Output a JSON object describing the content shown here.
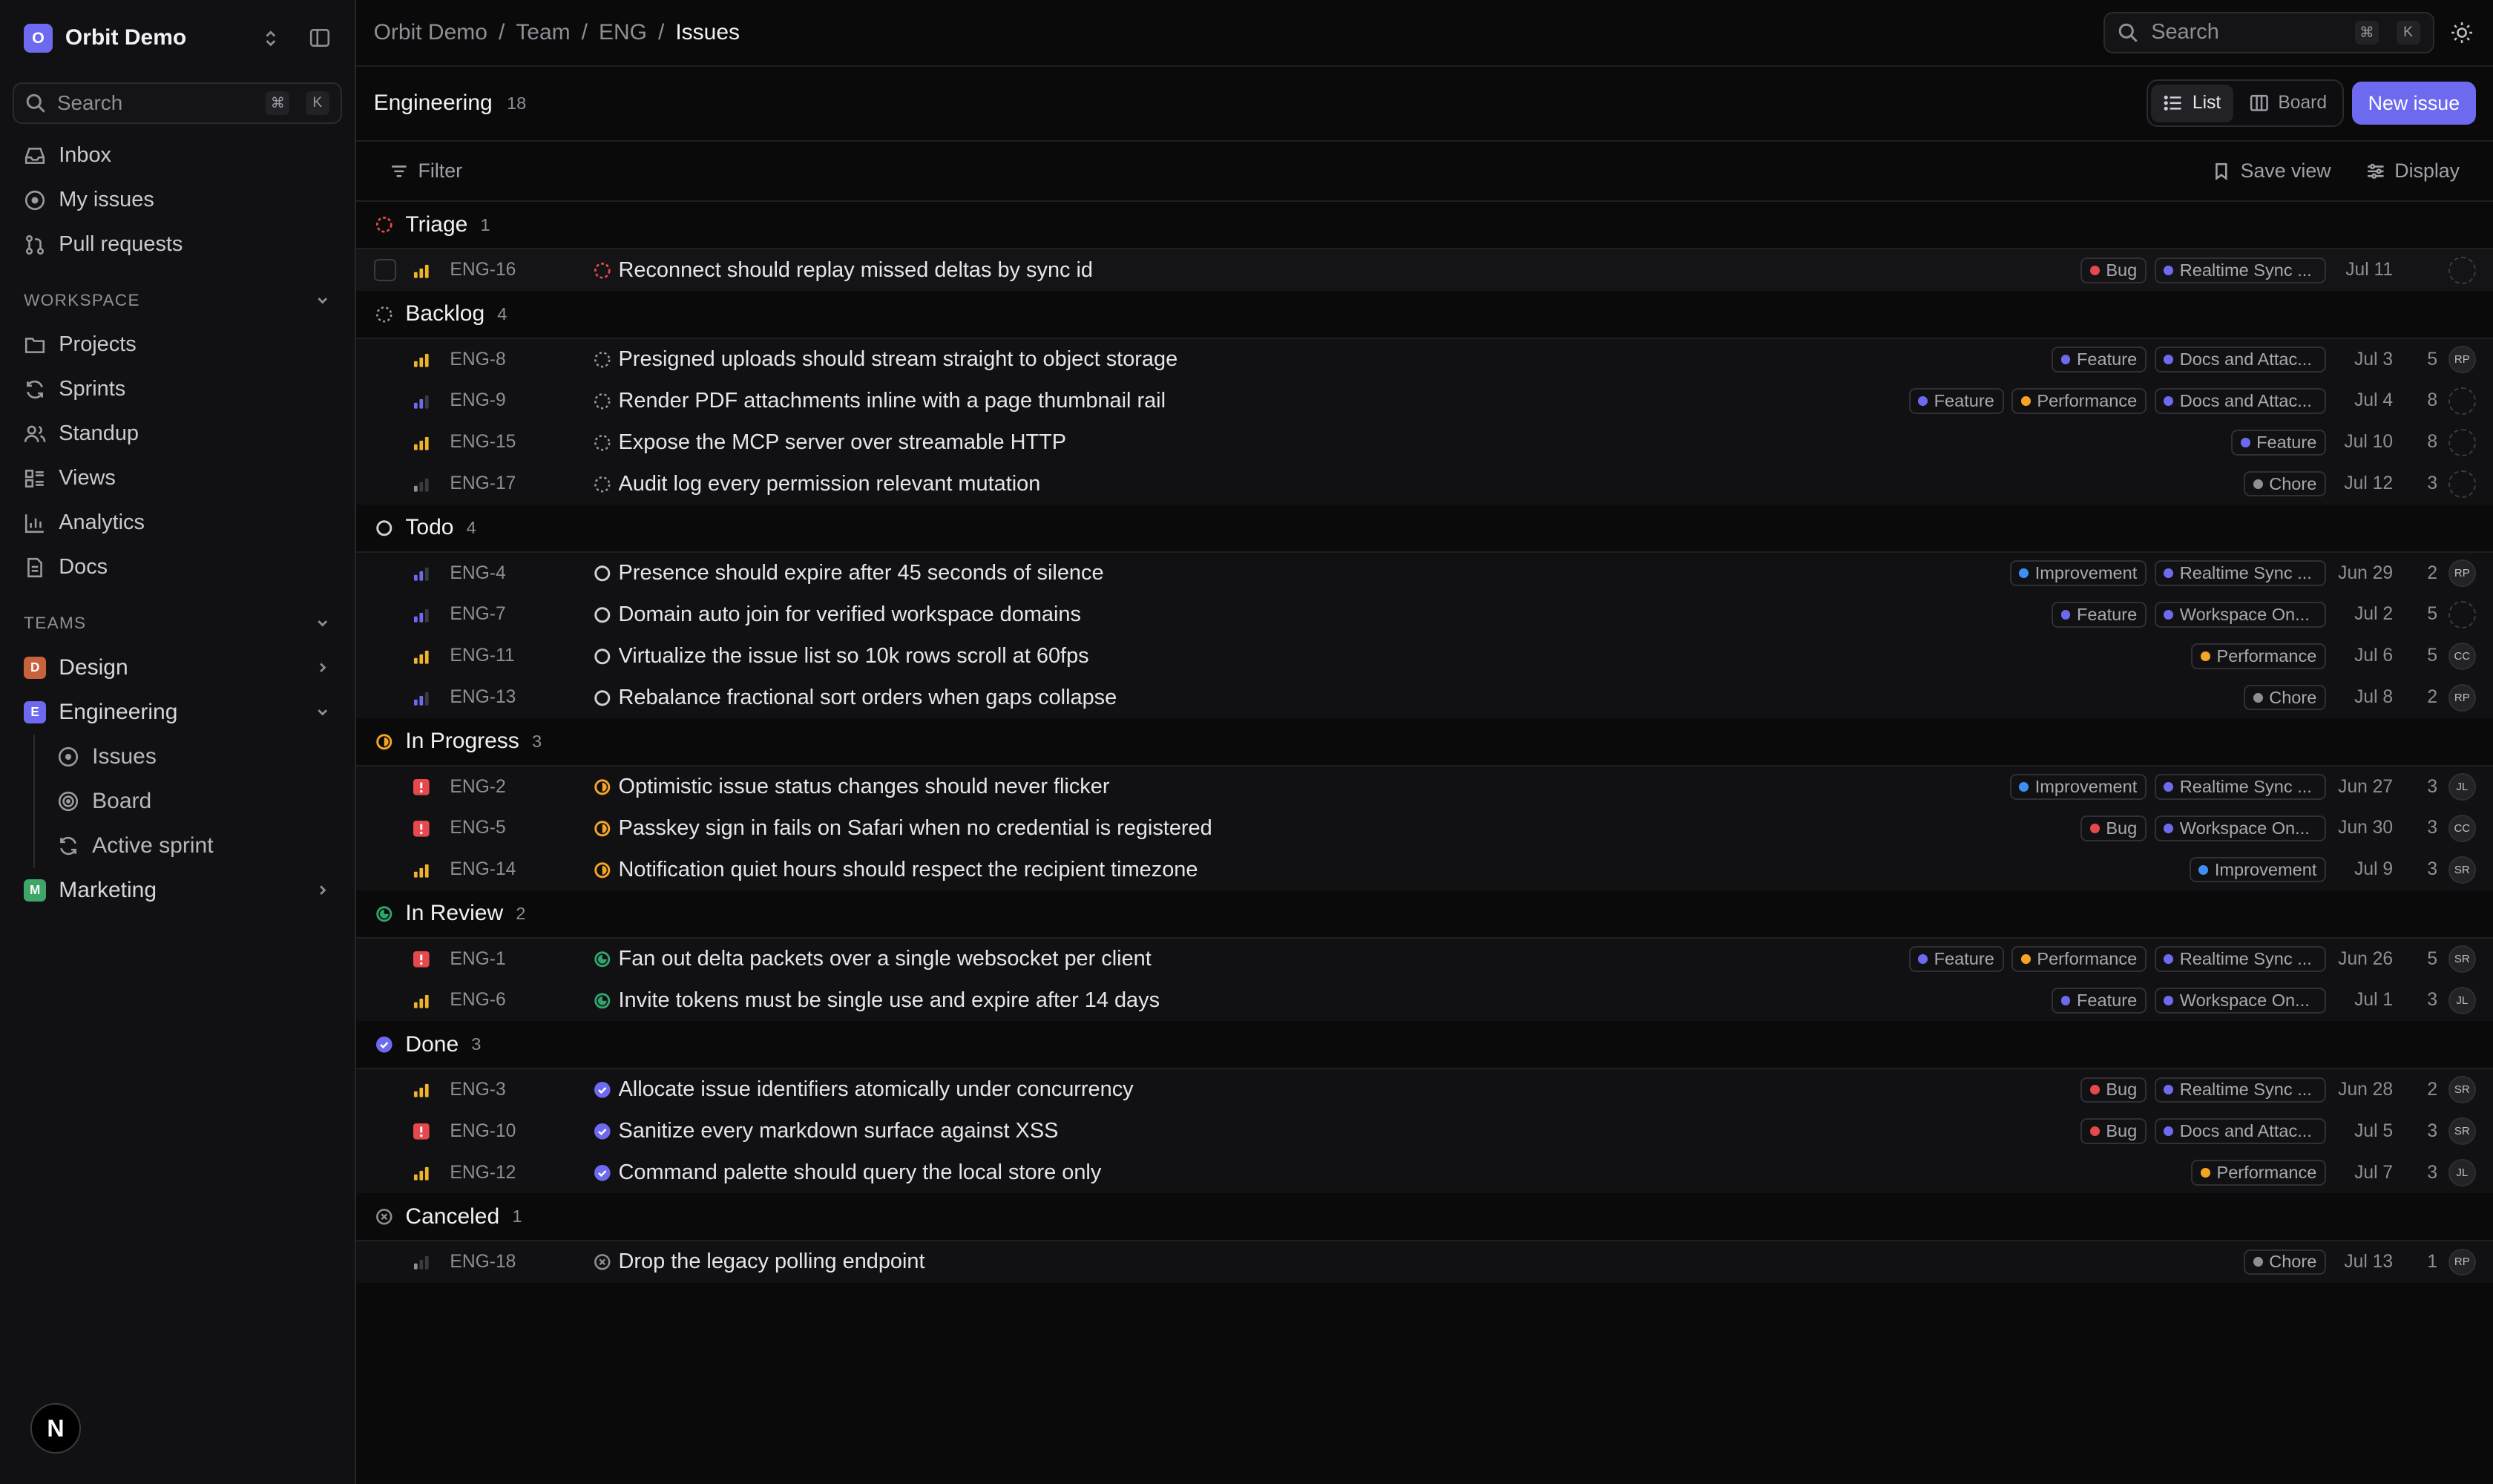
{
  "workspace": {
    "name": "Orbit Demo",
    "logo_letter": "O"
  },
  "sidebar": {
    "search": {
      "placeholder": "Search",
      "k1": "⌘",
      "k2": "K"
    },
    "items": [
      {
        "label": "Inbox",
        "icon": "inbox-icon"
      },
      {
        "label": "My issues",
        "icon": "circle-icon"
      },
      {
        "label": "Pull requests",
        "icon": "git-pull-request-icon"
      }
    ],
    "workspace_label": "WORKSPACE",
    "workspace_items": [
      {
        "label": "Projects",
        "icon": "folder-icon"
      },
      {
        "label": "Sprints",
        "icon": "refresh-icon"
      },
      {
        "label": "Standup",
        "icon": "users-icon"
      },
      {
        "label": "Views",
        "icon": "list-icon"
      },
      {
        "label": "Analytics",
        "icon": "bar-chart-icon"
      },
      {
        "label": "Docs",
        "icon": "document-icon"
      }
    ],
    "teams_label": "TEAMS",
    "teams": [
      {
        "letter": "D",
        "name": "Design",
        "color": "#c8623c"
      },
      {
        "letter": "E",
        "name": "Engineering",
        "color": "#6e6af0"
      },
      {
        "letter": "M",
        "name": "Marketing",
        "color": "#3fa66a"
      }
    ],
    "eng_sub": [
      "Issues",
      "Board",
      "Active sprint"
    ],
    "footer_logo": "N"
  },
  "breadcrumb": [
    "Orbit Demo",
    "Team",
    "ENG",
    "Issues"
  ],
  "top_search": {
    "placeholder": "Search",
    "k1": "⌘",
    "k2": "K"
  },
  "header": {
    "title": "Engineering",
    "count": "18",
    "list_label": "List",
    "board_label": "Board",
    "new_issue_label": "New issue"
  },
  "filterbar": {
    "filter": "Filter",
    "save_view": "Save view",
    "display": "Display"
  },
  "colors": {
    "accent": "#6e6af0",
    "triage": "#e5484d",
    "in_progress": "#f5a524",
    "in_review": "#30a46c",
    "done": "#6e6af0",
    "urgent": "#e5484d",
    "priority": "#f0b429",
    "low": "#6e6af0"
  },
  "groups": [
    {
      "name": "Triage",
      "status": "triage",
      "count": "1",
      "issues": [
        {
          "id": "ENG-16",
          "priority": "high",
          "title": "Reconnect should replay missed deltas by sync id",
          "labels": [
            {
              "name": "Bug",
              "color": "#e5484d"
            }
          ],
          "project": "Realtime Sync ...",
          "date": "Jul 11",
          "estimate": "",
          "assignee": "",
          "checkbox": true
        }
      ]
    },
    {
      "name": "Backlog",
      "status": "backlog",
      "count": "4",
      "issues": [
        {
          "id": "ENG-8",
          "priority": "high",
          "title": "Presigned uploads should stream straight to object storage",
          "labels": [
            {
              "name": "Feature",
              "color": "#6e6af0"
            }
          ],
          "project": "Docs and Attac...",
          "date": "Jul 3",
          "estimate": "5",
          "assignee": "RP"
        },
        {
          "id": "ENG-9",
          "priority": "medium",
          "title": "Render PDF attachments inline with a page thumbnail rail",
          "labels": [
            {
              "name": "Feature",
              "color": "#6e6af0"
            },
            {
              "name": "Performance",
              "color": "#f5a524"
            }
          ],
          "project": "Docs and Attac...",
          "date": "Jul 4",
          "estimate": "8",
          "assignee": ""
        },
        {
          "id": "ENG-15",
          "priority": "high",
          "title": "Expose the MCP server over streamable HTTP",
          "labels": [
            {
              "name": "Feature",
              "color": "#6e6af0"
            }
          ],
          "project": "",
          "date": "Jul 10",
          "estimate": "8",
          "assignee": ""
        },
        {
          "id": "ENG-17",
          "priority": "low",
          "title": "Audit log every permission relevant mutation",
          "labels": [
            {
              "name": "Chore",
              "color": "#8e8e96"
            }
          ],
          "project": "",
          "date": "Jul 12",
          "estimate": "3",
          "assignee": ""
        }
      ]
    },
    {
      "name": "Todo",
      "status": "todo",
      "count": "4",
      "issues": [
        {
          "id": "ENG-4",
          "priority": "medium",
          "title": "Presence should expire after 45 seconds of silence",
          "labels": [
            {
              "name": "Improvement",
              "color": "#3e8ef7"
            }
          ],
          "project": "Realtime Sync ...",
          "date": "Jun 29",
          "estimate": "2",
          "assignee": "RP"
        },
        {
          "id": "ENG-7",
          "priority": "medium",
          "title": "Domain auto join for verified workspace domains",
          "labels": [
            {
              "name": "Feature",
              "color": "#6e6af0"
            }
          ],
          "project": "Workspace On...",
          "date": "Jul 2",
          "estimate": "5",
          "assignee": ""
        },
        {
          "id": "ENG-11",
          "priority": "high",
          "title": "Virtualize the issue list so 10k rows scroll at 60fps",
          "labels": [
            {
              "name": "Performance",
              "color": "#f5a524"
            }
          ],
          "project": "",
          "date": "Jul 6",
          "estimate": "5",
          "assignee": "CC"
        },
        {
          "id": "ENG-13",
          "priority": "medium",
          "title": "Rebalance fractional sort orders when gaps collapse",
          "labels": [
            {
              "name": "Chore",
              "color": "#8e8e96"
            }
          ],
          "project": "",
          "date": "Jul 8",
          "estimate": "2",
          "assignee": "RP"
        }
      ]
    },
    {
      "name": "In Progress",
      "status": "in_progress",
      "count": "3",
      "issues": [
        {
          "id": "ENG-2",
          "priority": "urgent",
          "title": "Optimistic issue status changes should never flicker",
          "labels": [
            {
              "name": "Improvement",
              "color": "#3e8ef7"
            }
          ],
          "project": "Realtime Sync ...",
          "date": "Jun 27",
          "estimate": "3",
          "assignee": "JL"
        },
        {
          "id": "ENG-5",
          "priority": "urgent",
          "title": "Passkey sign in fails on Safari when no credential is registered",
          "labels": [
            {
              "name": "Bug",
              "color": "#e5484d"
            }
          ],
          "project": "Workspace On...",
          "date": "Jun 30",
          "estimate": "3",
          "assignee": "CC"
        },
        {
          "id": "ENG-14",
          "priority": "high",
          "title": "Notification quiet hours should respect the recipient timezone",
          "labels": [
            {
              "name": "Improvement",
              "color": "#3e8ef7"
            }
          ],
          "project": "",
          "date": "Jul 9",
          "estimate": "3",
          "assignee": "SR"
        }
      ]
    },
    {
      "name": "In Review",
      "status": "in_review",
      "count": "2",
      "issues": [
        {
          "id": "ENG-1",
          "priority": "urgent",
          "title": "Fan out delta packets over a single websocket per client",
          "labels": [
            {
              "name": "Feature",
              "color": "#6e6af0"
            },
            {
              "name": "Performance",
              "color": "#f5a524"
            }
          ],
          "project": "Realtime Sync ...",
          "date": "Jun 26",
          "estimate": "5",
          "assignee": "SR"
        },
        {
          "id": "ENG-6",
          "priority": "high",
          "title": "Invite tokens must be single use and expire after 14 days",
          "labels": [
            {
              "name": "Feature",
              "color": "#6e6af0"
            }
          ],
          "project": "Workspace On...",
          "date": "Jul 1",
          "estimate": "3",
          "assignee": "JL"
        }
      ]
    },
    {
      "name": "Done",
      "status": "done",
      "count": "3",
      "issues": [
        {
          "id": "ENG-3",
          "priority": "high",
          "title": "Allocate issue identifiers atomically under concurrency",
          "labels": [
            {
              "name": "Bug",
              "color": "#e5484d"
            }
          ],
          "project": "Realtime Sync ...",
          "date": "Jun 28",
          "estimate": "2",
          "assignee": "SR"
        },
        {
          "id": "ENG-10",
          "priority": "urgent",
          "title": "Sanitize every markdown surface against XSS",
          "labels": [
            {
              "name": "Bug",
              "color": "#e5484d"
            }
          ],
          "project": "Docs and Attac...",
          "date": "Jul 5",
          "estimate": "3",
          "assignee": "SR"
        },
        {
          "id": "ENG-12",
          "priority": "high",
          "title": "Command palette should query the local store only",
          "labels": [
            {
              "name": "Performance",
              "color": "#f5a524"
            }
          ],
          "project": "",
          "date": "Jul 7",
          "estimate": "3",
          "assignee": "JL"
        }
      ]
    },
    {
      "name": "Canceled",
      "status": "canceled",
      "count": "1",
      "issues": [
        {
          "id": "ENG-18",
          "priority": "low",
          "title": "Drop the legacy polling endpoint",
          "labels": [
            {
              "name": "Chore",
              "color": "#8e8e96"
            }
          ],
          "project": "",
          "date": "Jul 13",
          "estimate": "1",
          "assignee": "RP"
        }
      ]
    }
  ]
}
